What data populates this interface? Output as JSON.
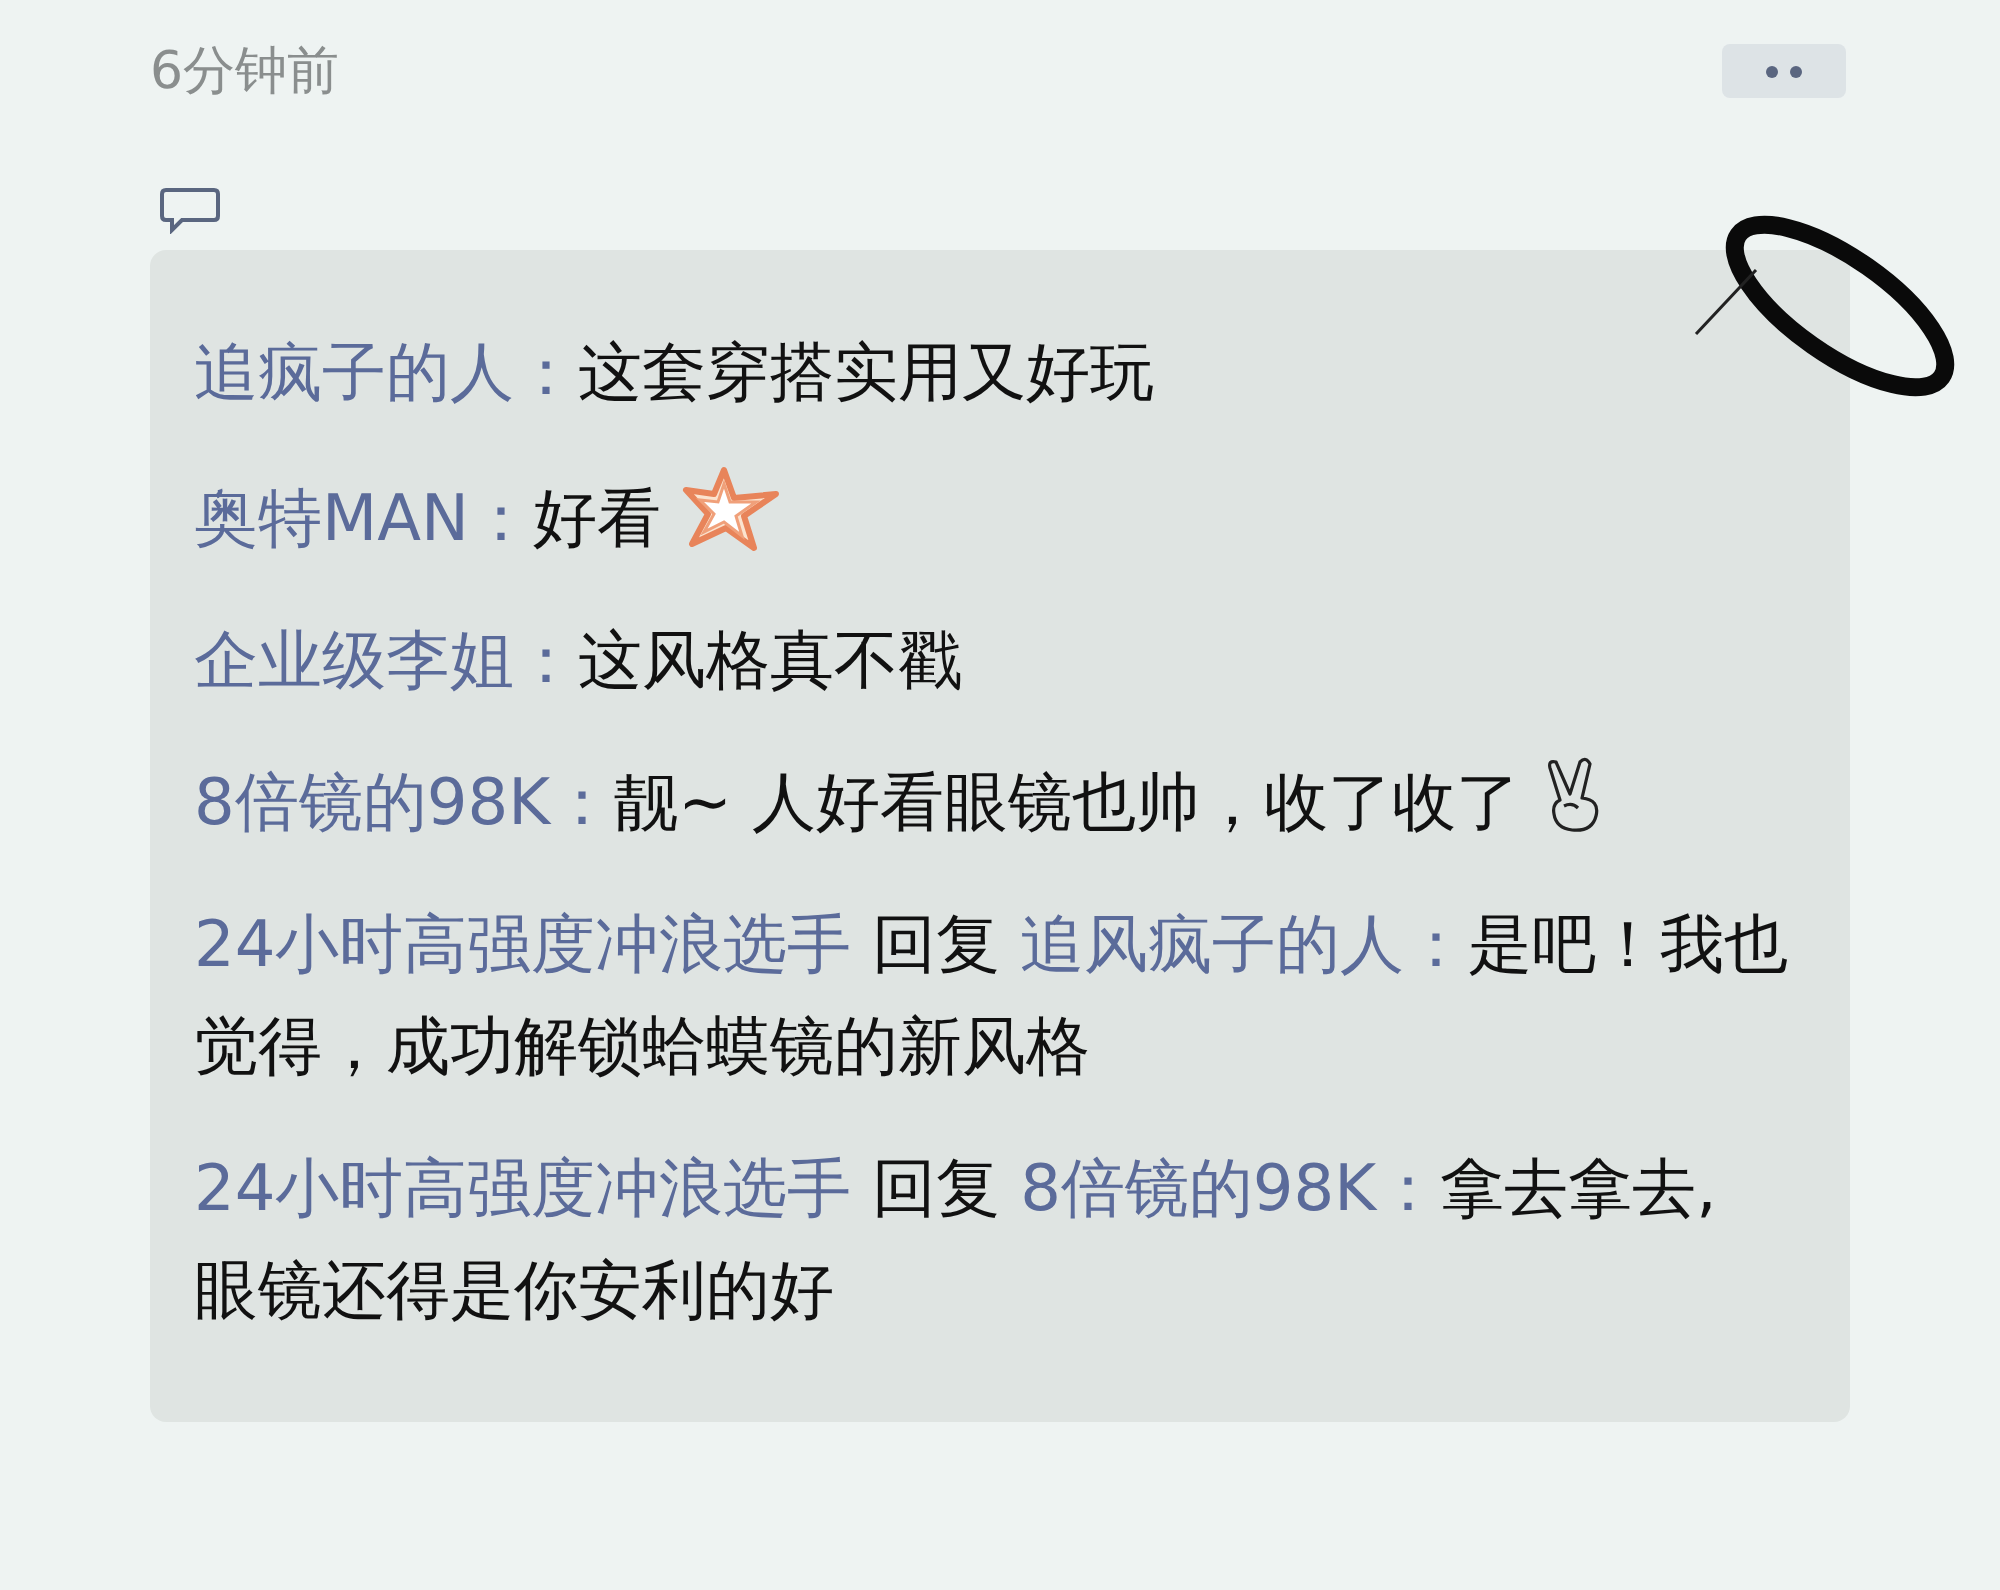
{
  "timestamp": "6分钟前",
  "comments": [
    {
      "author": "追疯子的人：",
      "text": "这套穿搭实用又好玩",
      "kind": "plain"
    },
    {
      "author": "奥特MAN：",
      "text": "好看",
      "kind": "star"
    },
    {
      "author": "企业级李姐：",
      "text": "这风格真不戳",
      "kind": "plain"
    },
    {
      "author": "8倍镜的98K：",
      "text": "靓~ 人好看眼镜也帅，收了收了",
      "kind": "hand"
    },
    {
      "author": "24小时高强度冲浪选手",
      "reply_word": "回复",
      "reply_to": "追风疯子的人：",
      "text": "是吧！我也觉得，成功解锁蛤蟆镜的新风格",
      "kind": "plain"
    },
    {
      "author": "24小时高强度冲浪选手",
      "reply_word": "回复",
      "reply_to": "8倍镜的98K：",
      "text": "拿去拿去, 眼镜还得是你安利的好",
      "kind": "plain"
    }
  ]
}
